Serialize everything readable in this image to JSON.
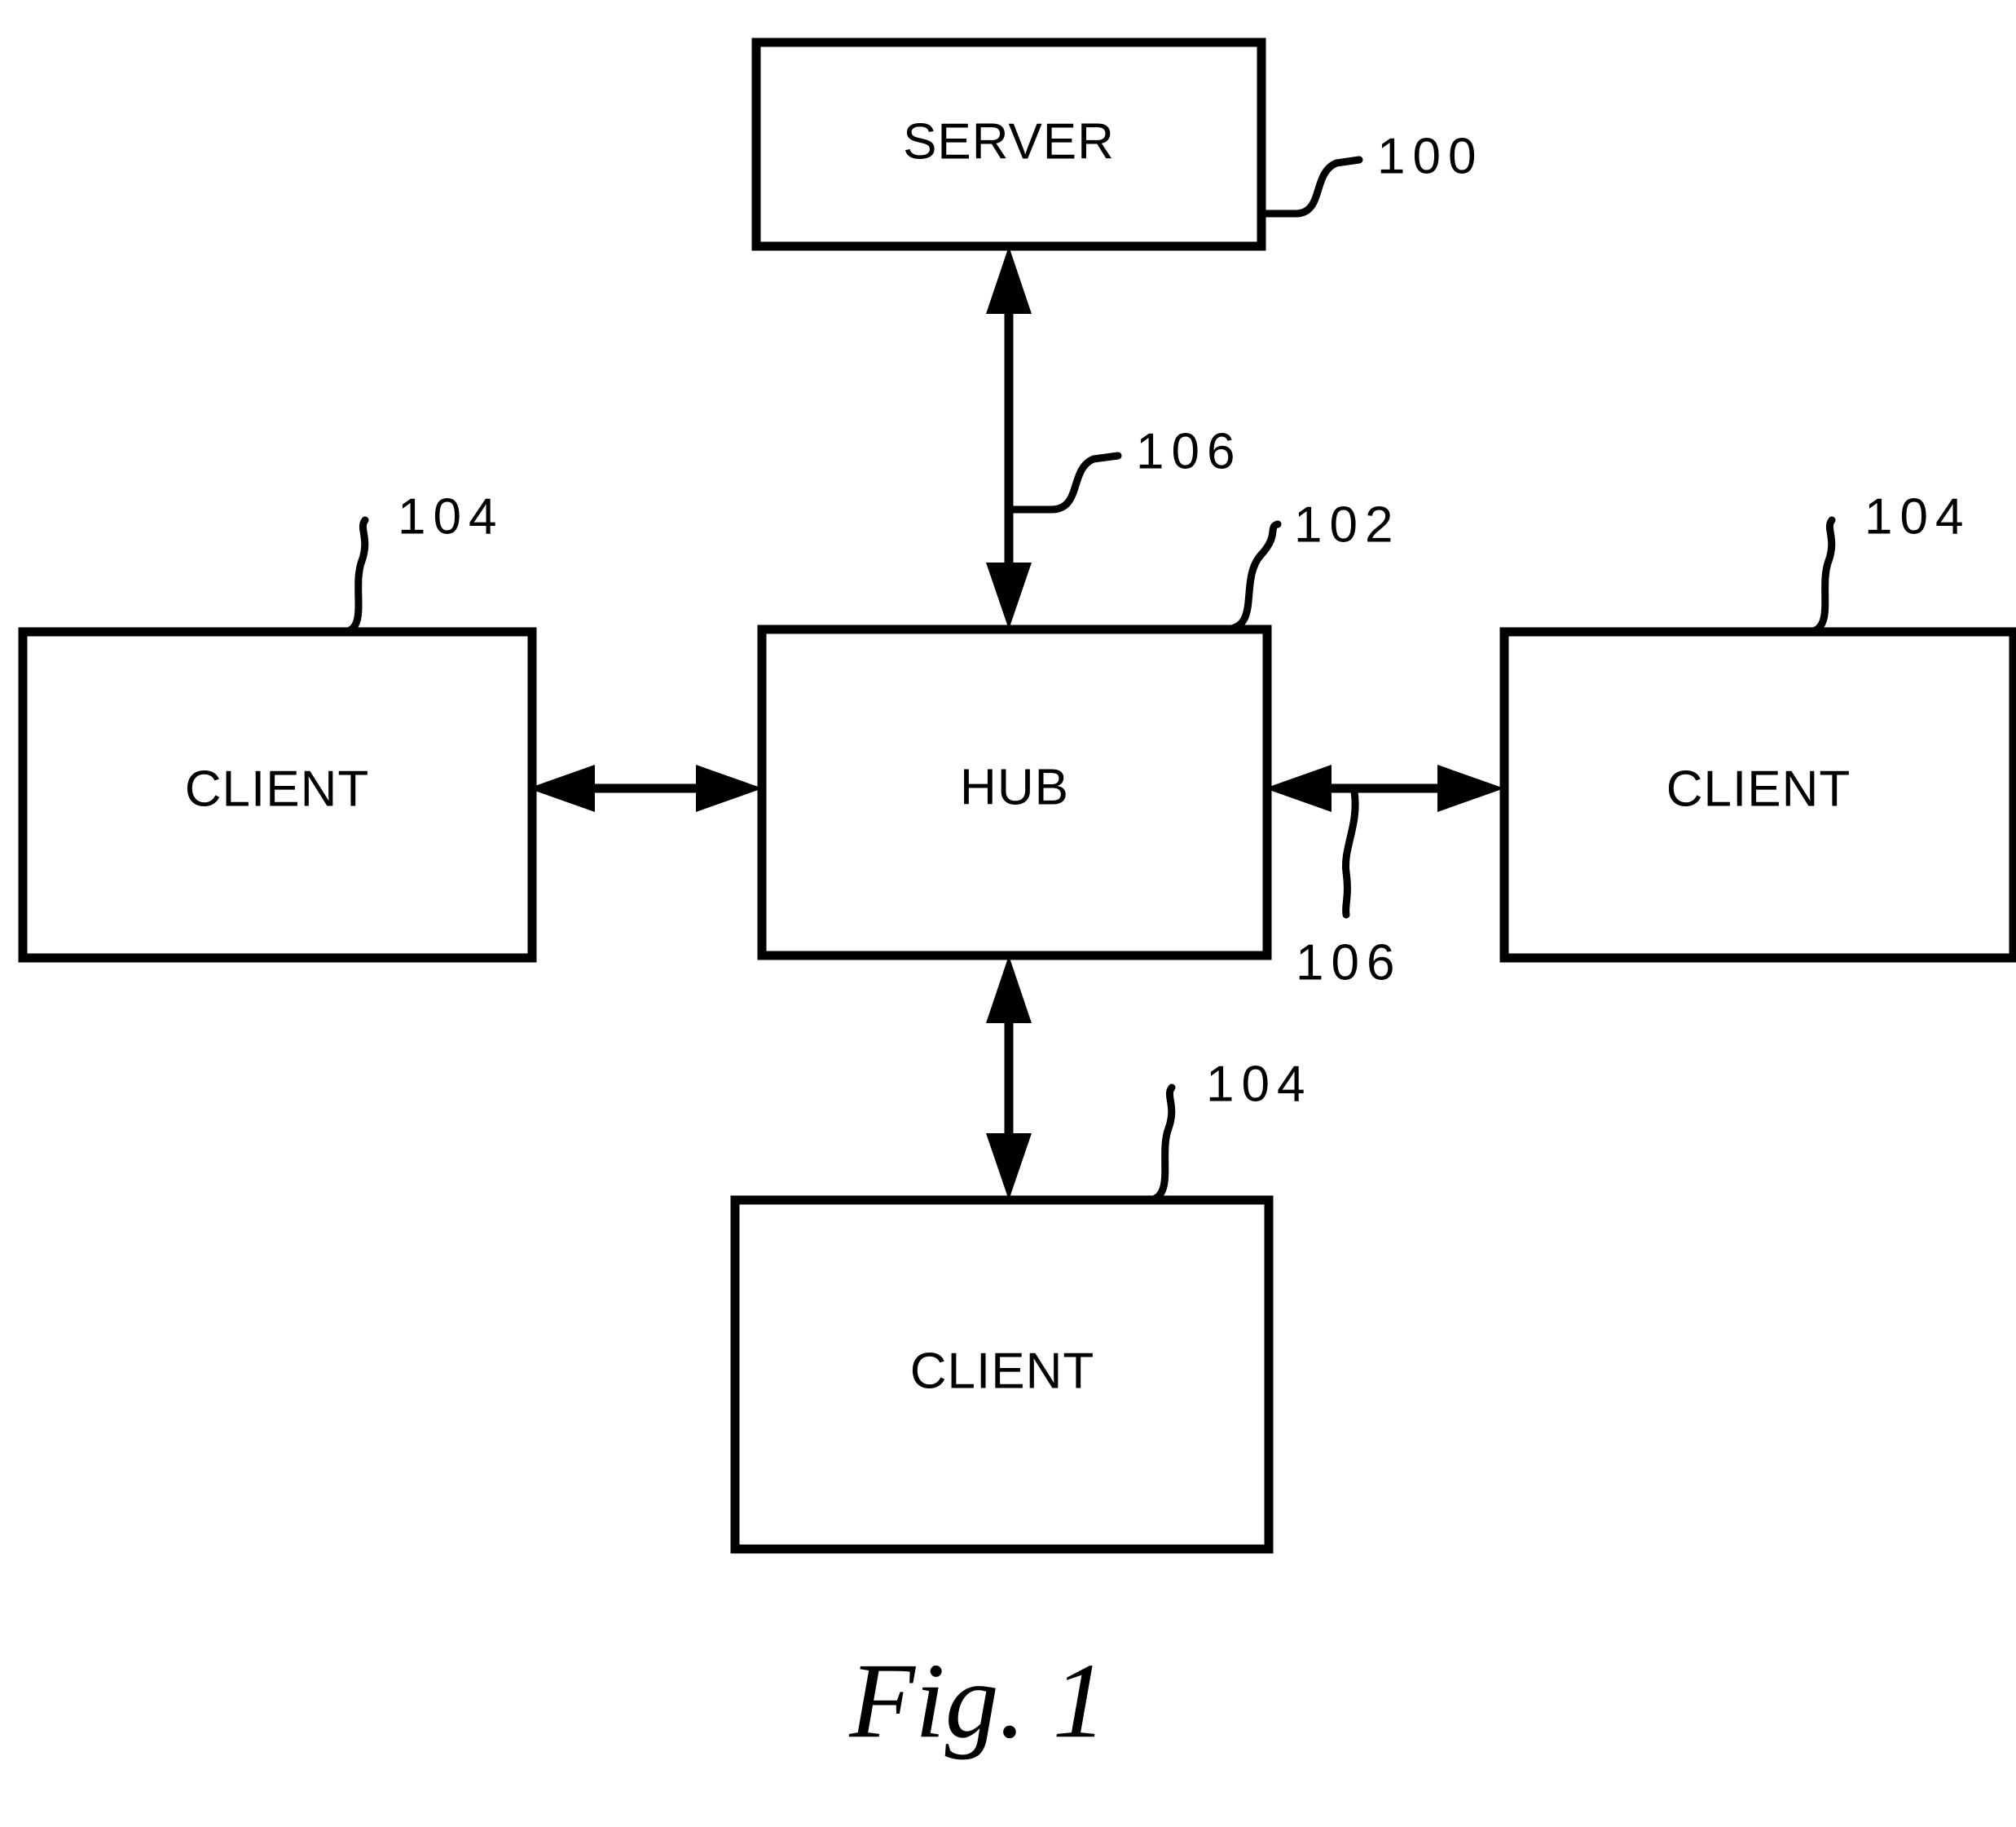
{
  "figure": {
    "caption": "Fig.  1",
    "type": "patent-block-diagram",
    "background_color": "#ffffff",
    "line_color": "#000000"
  },
  "nodes": [
    {
      "id": "server",
      "label": "SERVER",
      "ref": "100"
    },
    {
      "id": "hub",
      "label": "HUB",
      "ref": "102"
    },
    {
      "id": "client_left",
      "label": "CLIENT",
      "ref": "104"
    },
    {
      "id": "client_right",
      "label": "CLIENT",
      "ref": "104"
    },
    {
      "id": "client_bottom",
      "label": "CLIENT",
      "ref": "104"
    }
  ],
  "reference_numerals": {
    "server": "100",
    "hub": "102",
    "client_left": "104",
    "client_right": "104",
    "client_bottom": "104",
    "link_server_hub": "106",
    "link_hub_client_right": "106"
  },
  "connections": [
    {
      "from": "server",
      "to": "hub",
      "style": "double-arrow",
      "ref": "106"
    },
    {
      "from": "client_left",
      "to": "hub",
      "style": "double-arrow",
      "ref": ""
    },
    {
      "from": "hub",
      "to": "client_right",
      "style": "double-arrow",
      "ref": "106"
    },
    {
      "from": "hub",
      "to": "client_bottom",
      "style": "double-arrow",
      "ref": ""
    }
  ]
}
